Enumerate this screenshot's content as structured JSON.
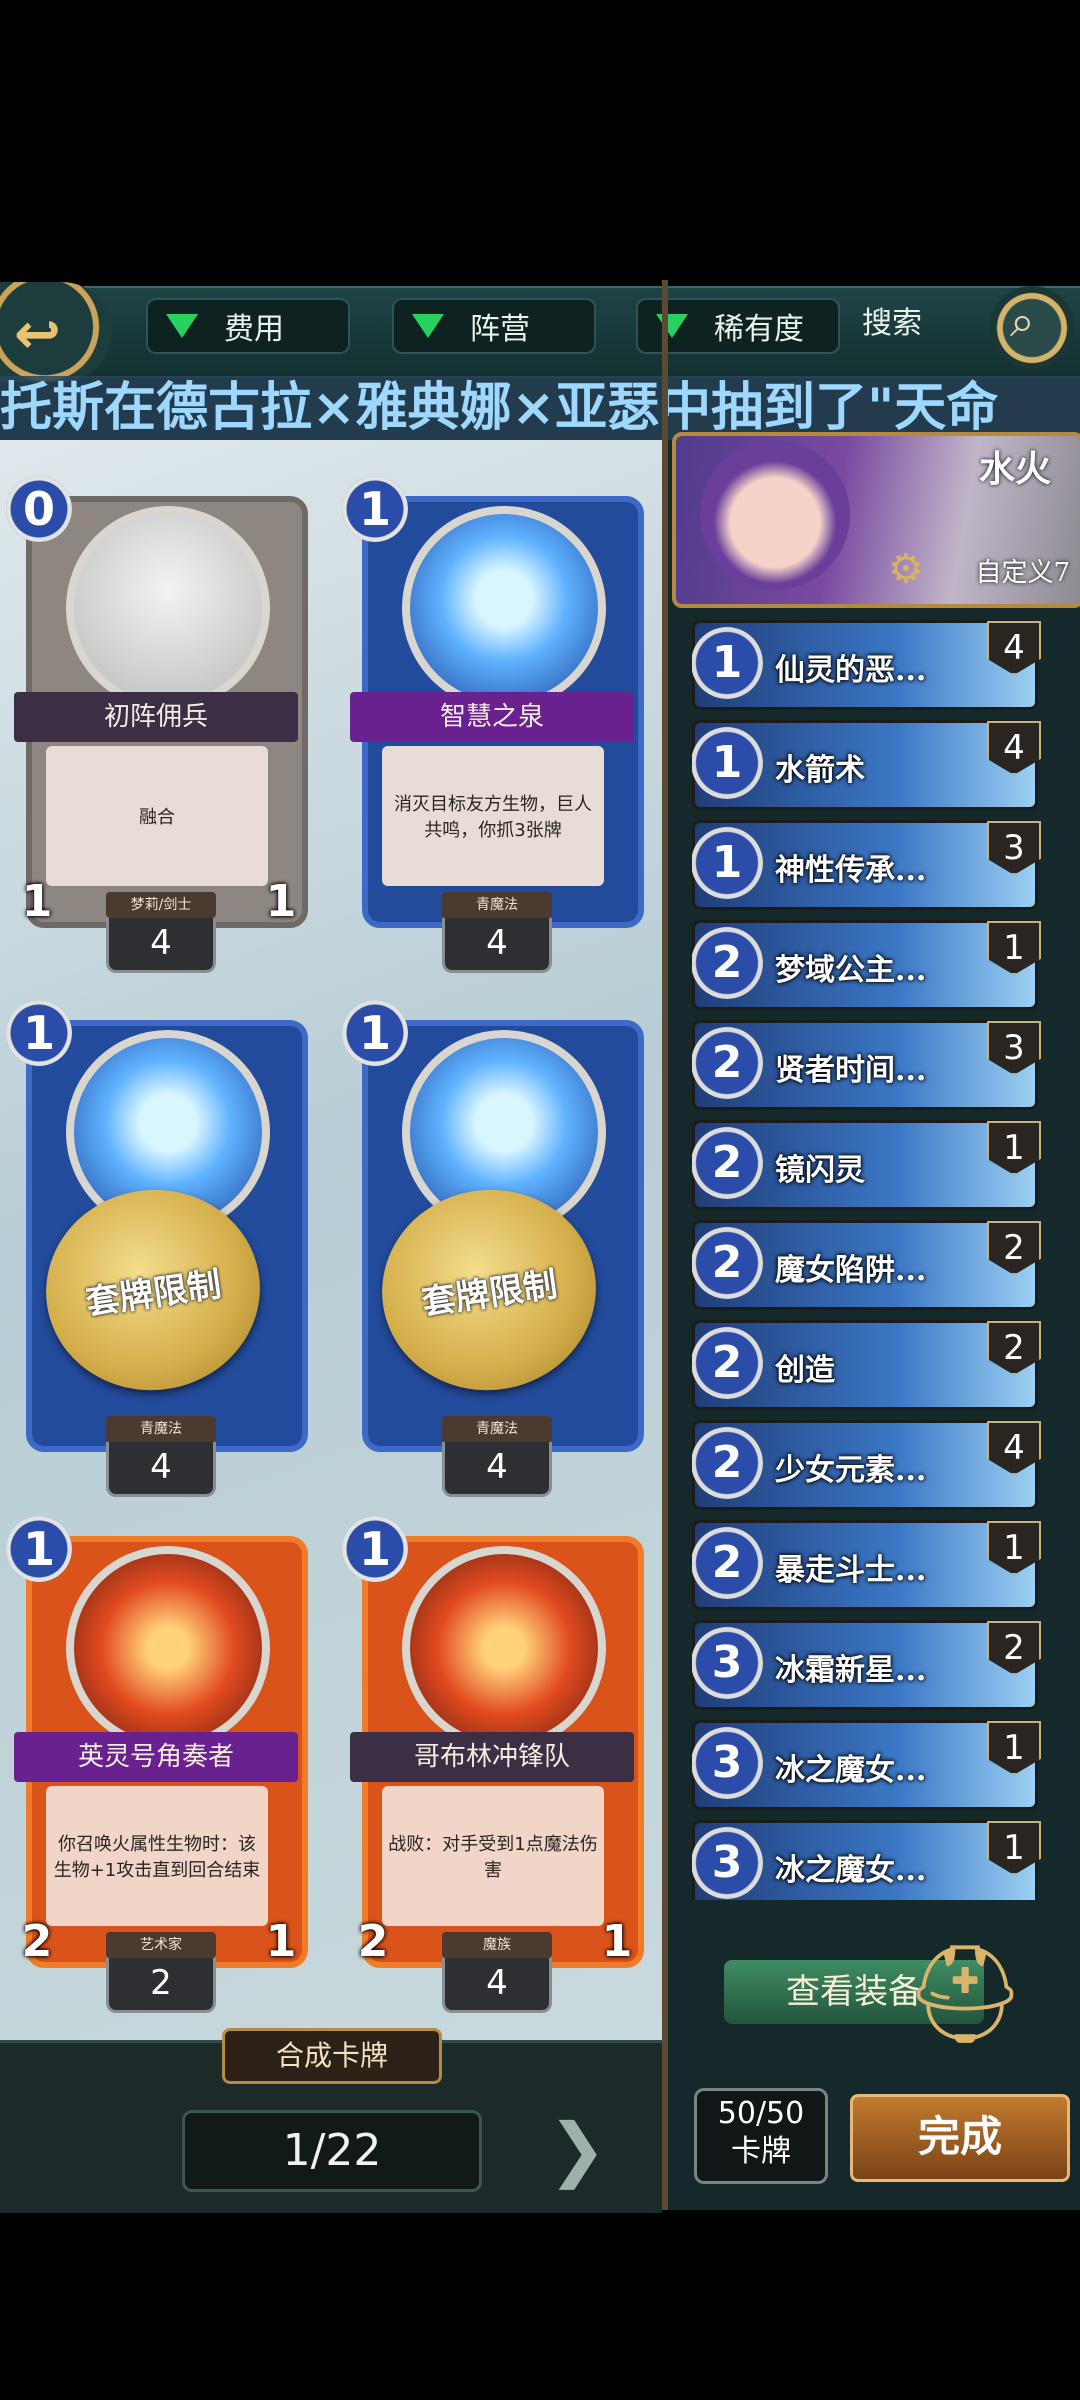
{
  "toolbar": {
    "filters": [
      {
        "label": "费用"
      },
      {
        "label": "阵营"
      },
      {
        "label": "稀有度"
      }
    ],
    "search_label": "搜索"
  },
  "ticker": "托斯在德古拉×雅典娜×亚瑟中抽到了\"天命",
  "cards": [
    {
      "cost": "0",
      "name": "初阵佣兵",
      "text": "融合",
      "tribe": "梦莉/剑士",
      "atk": "1",
      "hp": "1",
      "count": "4",
      "style": "grey"
    },
    {
      "cost": "1",
      "name": "智慧之泉",
      "text": "消灭目标友方生物，巨人共鸣，你抓3张牌",
      "tribe": "青魔法",
      "count": "4",
      "style": "blue"
    },
    {
      "cost": "1",
      "seal": "套牌限制",
      "tribe": "青魔法",
      "count": "4",
      "style": "blue"
    },
    {
      "cost": "1",
      "seal": "套牌限制",
      "tribe": "青魔法",
      "count": "4",
      "style": "blue"
    },
    {
      "cost": "1",
      "name": "英灵号角奏者",
      "text": "你召唤火属性生物时：该生物+1攻击直到回合结束",
      "tribe": "艺术家",
      "atk": "2",
      "hp": "1",
      "count": "2",
      "style": "orange"
    },
    {
      "cost": "1",
      "name": "哥布林冲锋队",
      "text": "战败：对手受到1点魔法伤害",
      "tribe": "魔族",
      "atk": "2",
      "hp": "1",
      "count": "4",
      "style": "orange"
    }
  ],
  "craft_label": "合成卡牌",
  "page_indicator": "1/22",
  "hero": {
    "title": "水火",
    "deck_name": "自定义7"
  },
  "deck_list": [
    {
      "cost": "1",
      "name": "仙灵的恶...",
      "count": "4"
    },
    {
      "cost": "1",
      "name": "水箭术",
      "count": "4"
    },
    {
      "cost": "1",
      "name": "神性传承...",
      "count": "3"
    },
    {
      "cost": "2",
      "name": "梦域公主...",
      "count": "1"
    },
    {
      "cost": "2",
      "name": "贤者时间...",
      "count": "3"
    },
    {
      "cost": "2",
      "name": "镜闪灵",
      "count": "1"
    },
    {
      "cost": "2",
      "name": "魔女陷阱...",
      "count": "2"
    },
    {
      "cost": "2",
      "name": "创造",
      "count": "2"
    },
    {
      "cost": "2",
      "name": "少女元素...",
      "count": "4"
    },
    {
      "cost": "2",
      "name": "暴走斗士...",
      "count": "1"
    },
    {
      "cost": "3",
      "name": "冰霜新星...",
      "count": "2"
    },
    {
      "cost": "3",
      "name": "冰之魔女...",
      "count": "1"
    },
    {
      "cost": "3",
      "name": "冰之魔女...",
      "count": "1"
    }
  ],
  "equip_label": "查看装备",
  "deck_count": {
    "value": "50/50",
    "label": "卡牌"
  },
  "done_label": "完成"
}
